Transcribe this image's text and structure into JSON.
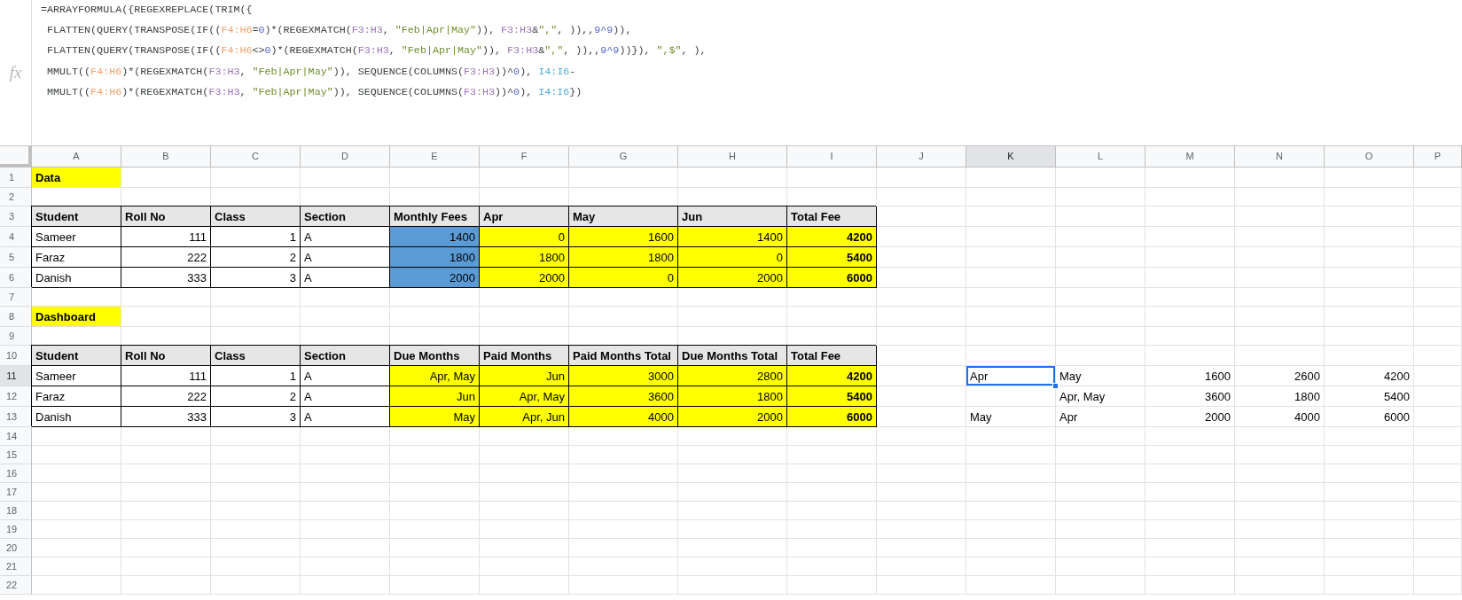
{
  "formula_bar": {
    "fx_icon": "fx",
    "lines": [
      {
        "tokens": [
          {
            "kind": "plain",
            "text": "=ARRAYFORMULA({REGEXREPLACE(TRIM({"
          }
        ]
      },
      {
        "tokens": [
          {
            "kind": "plain",
            "text": " FLATTEN(QUERY(TRANSPOSE(IF(("
          },
          {
            "kind": "ref",
            "text": "F4:H6",
            "color": "#f6a06a"
          },
          {
            "kind": "plain",
            "text": "="
          },
          {
            "kind": "number",
            "text": "0"
          },
          {
            "kind": "plain",
            "text": ")*(REGEXMATCH("
          },
          {
            "kind": "ref",
            "text": "F3:H3",
            "color": "#9b72b5"
          },
          {
            "kind": "plain",
            "text": ", "
          },
          {
            "kind": "string",
            "text": "\"Feb|Apr|May\""
          },
          {
            "kind": "plain",
            "text": ")), "
          },
          {
            "kind": "ref",
            "text": "F3:H3",
            "color": "#9b72b5"
          },
          {
            "kind": "plain",
            "text": "&"
          },
          {
            "kind": "string",
            "text": "\",\""
          },
          {
            "kind": "plain",
            "text": ", )),,"
          },
          {
            "kind": "number",
            "text": "9^9"
          },
          {
            "kind": "plain",
            "text": ")),"
          }
        ]
      },
      {
        "tokens": [
          {
            "kind": "plain",
            "text": " FLATTEN(QUERY(TRANSPOSE(IF(("
          },
          {
            "kind": "ref",
            "text": "F4:H6",
            "color": "#f6a06a"
          },
          {
            "kind": "plain",
            "text": "<>"
          },
          {
            "kind": "number",
            "text": "0"
          },
          {
            "kind": "plain",
            "text": ")*(REGEXMATCH("
          },
          {
            "kind": "ref",
            "text": "F3:H3",
            "color": "#9b72b5"
          },
          {
            "kind": "plain",
            "text": ", "
          },
          {
            "kind": "string",
            "text": "\"Feb|Apr|May\""
          },
          {
            "kind": "plain",
            "text": ")), "
          },
          {
            "kind": "ref",
            "text": "F3:H3",
            "color": "#9b72b5"
          },
          {
            "kind": "plain",
            "text": "&"
          },
          {
            "kind": "string",
            "text": "\",\""
          },
          {
            "kind": "plain",
            "text": ", )),,"
          },
          {
            "kind": "number",
            "text": "9^9"
          },
          {
            "kind": "plain",
            "text": "))}), "
          },
          {
            "kind": "string",
            "text": "\",$\""
          },
          {
            "kind": "plain",
            "text": ", ),"
          }
        ]
      },
      {
        "tokens": [
          {
            "kind": "plain",
            "text": " MMULT(("
          },
          {
            "kind": "ref",
            "text": "F4:H6",
            "color": "#f6a06a"
          },
          {
            "kind": "plain",
            "text": ")*(REGEXMATCH("
          },
          {
            "kind": "ref",
            "text": "F3:H3",
            "color": "#9b72b5"
          },
          {
            "kind": "plain",
            "text": ", "
          },
          {
            "kind": "string",
            "text": "\"Feb|Apr|May\""
          },
          {
            "kind": "plain",
            "text": ")), SEQUENCE(COLUMNS("
          },
          {
            "kind": "ref",
            "text": "F3:H3",
            "color": "#9b72b5"
          },
          {
            "kind": "plain",
            "text": "))^"
          },
          {
            "kind": "number",
            "text": "0"
          },
          {
            "kind": "plain",
            "text": "), "
          },
          {
            "kind": "ref",
            "text": "I4:I6",
            "color": "#4fa8d8"
          },
          {
            "kind": "plain",
            "text": "-"
          }
        ]
      },
      {
        "tokens": [
          {
            "kind": "plain",
            "text": " MMULT(("
          },
          {
            "kind": "ref",
            "text": "F4:H6",
            "color": "#f6a06a"
          },
          {
            "kind": "plain",
            "text": ")*(REGEXMATCH("
          },
          {
            "kind": "ref",
            "text": "F3:H3",
            "color": "#9b72b5"
          },
          {
            "kind": "plain",
            "text": ", "
          },
          {
            "kind": "string",
            "text": "\"Feb|Apr|May\""
          },
          {
            "kind": "plain",
            "text": ")), SEQUENCE(COLUMNS("
          },
          {
            "kind": "ref",
            "text": "F3:H3",
            "color": "#9b72b5"
          },
          {
            "kind": "plain",
            "text": "))^"
          },
          {
            "kind": "number",
            "text": "0"
          },
          {
            "kind": "plain",
            "text": "), "
          },
          {
            "kind": "ref",
            "text": "I4:I6",
            "color": "#4fa8d8"
          },
          {
            "kind": "plain",
            "text": "})"
          }
        ]
      }
    ]
  },
  "sheet": {
    "columns": [
      {
        "label": "A",
        "selected": false
      },
      {
        "label": "B",
        "selected": false
      },
      {
        "label": "C",
        "selected": false
      },
      {
        "label": "D",
        "selected": false
      },
      {
        "label": "E",
        "selected": false
      },
      {
        "label": "F",
        "selected": false
      },
      {
        "label": "G",
        "selected": false
      },
      {
        "label": "H",
        "selected": false
      },
      {
        "label": "I",
        "selected": false
      },
      {
        "label": "J",
        "selected": false
      },
      {
        "label": "K",
        "selected": true
      },
      {
        "label": "L",
        "selected": false
      },
      {
        "label": "M",
        "selected": false
      },
      {
        "label": "N",
        "selected": false
      },
      {
        "label": "O",
        "selected": false
      },
      {
        "label": "P",
        "selected": false
      }
    ],
    "rows": [
      {
        "label": "1",
        "selected": false,
        "cells": [
          {
            "kind": "title",
            "text": "Data"
          }
        ]
      },
      {
        "label": "2",
        "selected": false
      },
      {
        "label": "3",
        "selected": false,
        "cells": [
          {
            "kind": "header",
            "text": "Student"
          },
          {
            "kind": "header",
            "text": "Roll No"
          },
          {
            "kind": "header",
            "text": "Class"
          },
          {
            "kind": "header",
            "text": "Section"
          },
          {
            "kind": "header",
            "text": "Monthly Fees"
          },
          {
            "kind": "header",
            "text": "Apr"
          },
          {
            "kind": "header",
            "text": "May"
          },
          {
            "kind": "header",
            "text": "Jun"
          },
          {
            "kind": "header",
            "text": "Total Fee"
          }
        ]
      },
      {
        "label": "4",
        "selected": false,
        "cells": [
          {
            "kind": "text",
            "text": "Sameer"
          },
          {
            "kind": "number",
            "text": "111"
          },
          {
            "kind": "number",
            "text": "1"
          },
          {
            "kind": "text",
            "text": "A"
          },
          {
            "kind": "fee",
            "text": "1400"
          },
          {
            "kind": "amount",
            "text": "0"
          },
          {
            "kind": "amount",
            "text": "1600"
          },
          {
            "kind": "amount",
            "text": "1400"
          },
          {
            "kind": "total",
            "text": "4200"
          }
        ]
      },
      {
        "label": "5",
        "selected": false,
        "cells": [
          {
            "kind": "text",
            "text": "Faraz"
          },
          {
            "kind": "number",
            "text": "222"
          },
          {
            "kind": "number",
            "text": "2"
          },
          {
            "kind": "text",
            "text": "A"
          },
          {
            "kind": "fee",
            "text": "1800"
          },
          {
            "kind": "amount",
            "text": "1800"
          },
          {
            "kind": "amount",
            "text": "1800"
          },
          {
            "kind": "amount",
            "text": "0"
          },
          {
            "kind": "total",
            "text": "5400"
          }
        ]
      },
      {
        "label": "6",
        "selected": false,
        "cells": [
          {
            "kind": "text",
            "text": "Danish"
          },
          {
            "kind": "number",
            "text": "333"
          },
          {
            "kind": "number",
            "text": "3"
          },
          {
            "kind": "text",
            "text": "A"
          },
          {
            "kind": "fee",
            "text": "2000"
          },
          {
            "kind": "amount",
            "text": "2000"
          },
          {
            "kind": "amount",
            "text": "0"
          },
          {
            "kind": "amount",
            "text": "2000"
          },
          {
            "kind": "total",
            "text": "6000"
          }
        ]
      },
      {
        "label": "7",
        "selected": false
      },
      {
        "label": "8",
        "selected": false,
        "cells": [
          {
            "kind": "title",
            "text": "Dashboard"
          }
        ]
      },
      {
        "label": "9",
        "selected": false
      },
      {
        "label": "10",
        "selected": false,
        "cells": [
          {
            "kind": "header",
            "text": "Student"
          },
          {
            "kind": "header",
            "text": "Roll No"
          },
          {
            "kind": "header",
            "text": "Class"
          },
          {
            "kind": "header",
            "text": "Section"
          },
          {
            "kind": "header",
            "text": "Due Months"
          },
          {
            "kind": "header",
            "text": "Paid Months"
          },
          {
            "kind": "header",
            "text": "Paid Months Total"
          },
          {
            "kind": "header",
            "text": "Due Months Total"
          },
          {
            "kind": "header",
            "text": "Total Fee"
          }
        ]
      },
      {
        "label": "11",
        "selected": true,
        "cells": [
          {
            "kind": "text",
            "text": "Sameer"
          },
          {
            "kind": "number",
            "text": "111"
          },
          {
            "kind": "number",
            "text": "1"
          },
          {
            "kind": "text",
            "text": "A"
          },
          {
            "kind": "amount",
            "text": "Apr, May"
          },
          {
            "kind": "amount",
            "text": "Jun"
          },
          {
            "kind": "amount",
            "text": "3000"
          },
          {
            "kind": "amount",
            "text": "2800"
          },
          {
            "kind": "total",
            "text": "4200"
          },
          {
            "kind": "empty"
          },
          {
            "kind": "plain",
            "text": "Apr"
          },
          {
            "kind": "plain",
            "text": "May"
          },
          {
            "kind": "plain-number",
            "text": "1600"
          },
          {
            "kind": "plain-number",
            "text": "2600"
          },
          {
            "kind": "plain-number",
            "text": "4200"
          }
        ]
      },
      {
        "label": "12",
        "selected": false,
        "cells": [
          {
            "kind": "text",
            "text": "Faraz"
          },
          {
            "kind": "number",
            "text": "222"
          },
          {
            "kind": "number",
            "text": "2"
          },
          {
            "kind": "text",
            "text": "A"
          },
          {
            "kind": "amount",
            "text": "Jun"
          },
          {
            "kind": "amount",
            "text": "Apr, May"
          },
          {
            "kind": "amount",
            "text": "3600"
          },
          {
            "kind": "amount",
            "text": "1800"
          },
          {
            "kind": "total",
            "text": "5400"
          },
          {
            "kind": "empty"
          },
          {
            "kind": "empty"
          },
          {
            "kind": "plain",
            "text": "Apr, May"
          },
          {
            "kind": "plain-number",
            "text": "3600"
          },
          {
            "kind": "plain-number",
            "text": "1800"
          },
          {
            "kind": "plain-number",
            "text": "5400"
          }
        ]
      },
      {
        "label": "13",
        "selected": false,
        "cells": [
          {
            "kind": "text",
            "text": "Danish"
          },
          {
            "kind": "number",
            "text": "333"
          },
          {
            "kind": "number",
            "text": "3"
          },
          {
            "kind": "text",
            "text": "A"
          },
          {
            "kind": "amount",
            "text": "May"
          },
          {
            "kind": "amount",
            "text": "Apr, Jun"
          },
          {
            "kind": "amount",
            "text": "4000"
          },
          {
            "kind": "amount",
            "text": "2000"
          },
          {
            "kind": "total",
            "text": "6000"
          },
          {
            "kind": "empty"
          },
          {
            "kind": "plain",
            "text": "May"
          },
          {
            "kind": "plain",
            "text": "Apr"
          },
          {
            "kind": "plain-number",
            "text": "2000"
          },
          {
            "kind": "plain-number",
            "text": "4000"
          },
          {
            "kind": "plain-number",
            "text": "6000"
          }
        ]
      },
      {
        "label": "14",
        "selected": false
      },
      {
        "label": "15",
        "selected": false
      },
      {
        "label": "16",
        "selected": false
      },
      {
        "label": "17",
        "selected": false
      },
      {
        "label": "18",
        "selected": false
      },
      {
        "label": "19",
        "selected": false
      },
      {
        "label": "20",
        "selected": false
      },
      {
        "label": "21",
        "selected": false
      },
      {
        "label": "22",
        "selected": false
      }
    ]
  }
}
